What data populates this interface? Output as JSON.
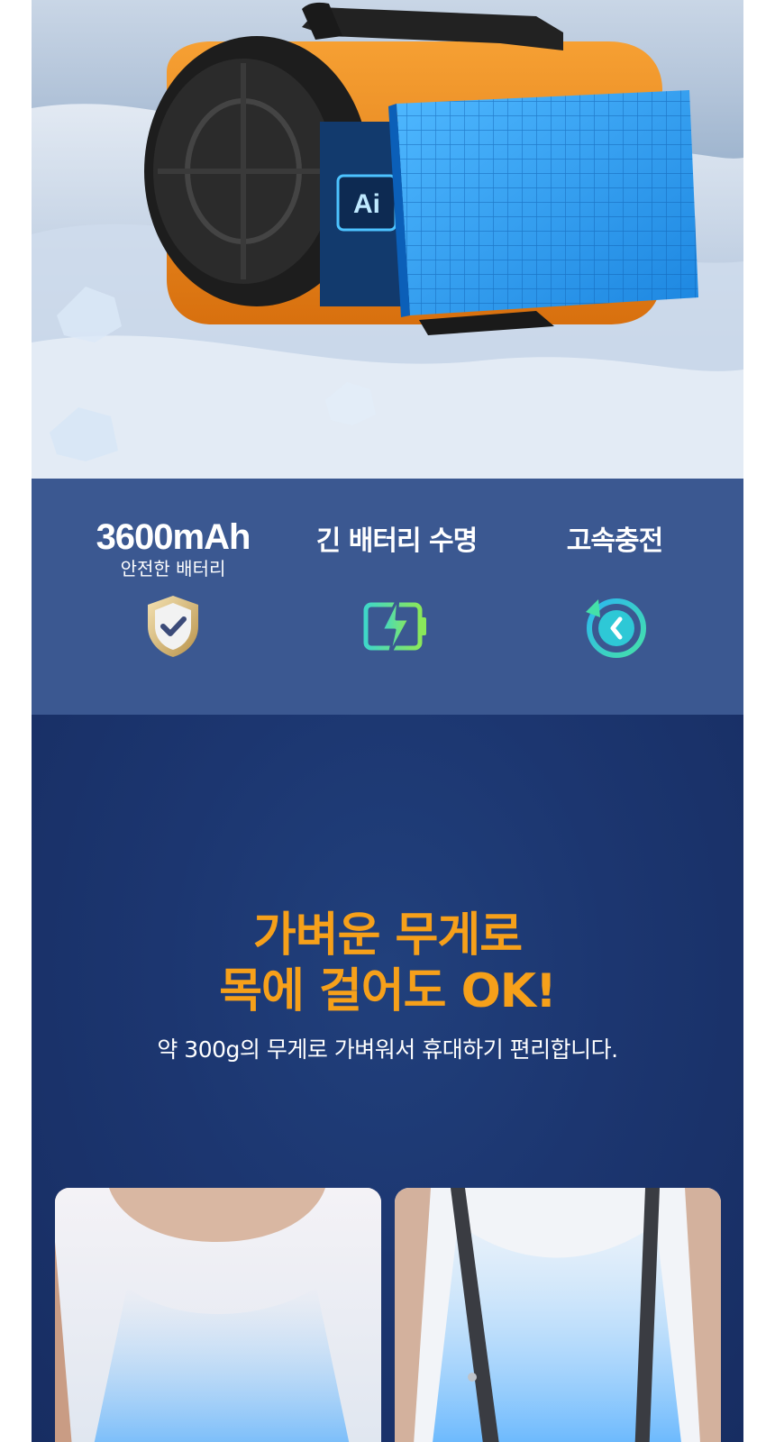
{
  "hero": {
    "chip_label": "Ai",
    "background": "snow-ice",
    "product": "orange-neck-fan"
  },
  "features": [
    {
      "headline": "3600mAh",
      "subtitle": "안전한 배터리",
      "icon": "shield-check-icon"
    },
    {
      "title": "긴 배터리 수명",
      "icon": "battery-bolt-icon"
    },
    {
      "title": "고속충전",
      "icon": "fast-charge-clock-icon"
    }
  ],
  "promo": {
    "headline_line1": "가벼운 무게로",
    "headline_line2": "목에 걸어도 OK!",
    "subline": "약 300g의 무게로 가벼워서 휴대하기 편리합니다."
  },
  "colors": {
    "feature_bg": "#3b5891",
    "promo_bg": "#1c3670",
    "accent_orange": "#f6a01a",
    "product_orange": "#f08a1c"
  }
}
